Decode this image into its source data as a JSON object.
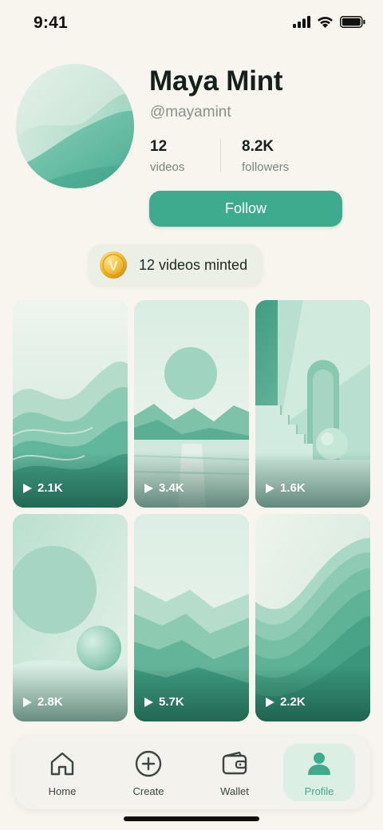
{
  "status_bar": {
    "time": "9:41"
  },
  "profile": {
    "name": "Maya Mint",
    "handle": "@mayamint",
    "stats": [
      {
        "value": "12",
        "label": "videos"
      },
      {
        "value": "8.2K",
        "label": "followers"
      }
    ],
    "follow_label": "Follow"
  },
  "minted_badge": {
    "coin_letter": "V",
    "text": "12 videos minted"
  },
  "videos": [
    {
      "views": "2.1K",
      "theme": "waves"
    },
    {
      "views": "3.4K",
      "theme": "sun-lake"
    },
    {
      "views": "1.6K",
      "theme": "stairs-arch"
    },
    {
      "views": "2.8K",
      "theme": "sphere"
    },
    {
      "views": "5.7K",
      "theme": "mountains"
    },
    {
      "views": "2.2K",
      "theme": "ripple"
    }
  ],
  "nav": {
    "items": [
      {
        "label": "Home",
        "icon": "home-icon"
      },
      {
        "label": "Create",
        "icon": "plus-circle-icon"
      },
      {
        "label": "Wallet",
        "icon": "wallet-icon"
      },
      {
        "label": "Profile",
        "icon": "person-icon",
        "active": true
      }
    ]
  },
  "colors": {
    "accent": "#3fab8e",
    "background": "#f8f5ee",
    "active_nav_bg": "#dcefe4"
  }
}
